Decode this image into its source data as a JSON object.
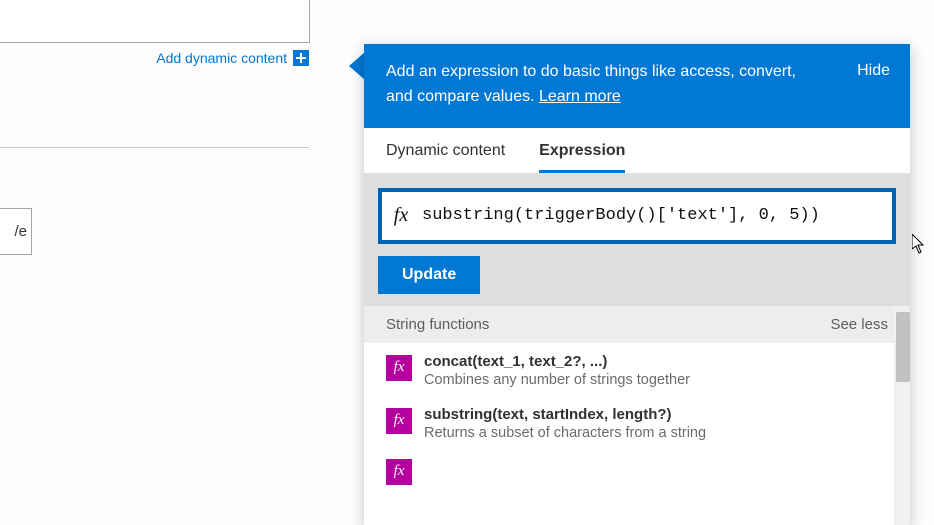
{
  "left": {
    "add_dynamic_label": "Add dynamic content",
    "save_fragment": "/e"
  },
  "header": {
    "description_prefix": "Add an expression to do basic things like access, convert, and compare values. ",
    "learn_more_label": "Learn more",
    "hide_label": "Hide"
  },
  "tabs": {
    "dynamic": "Dynamic content",
    "expression": "Expression",
    "active": "expression"
  },
  "expression": {
    "fx_label": "fx",
    "value": "substring(triggerBody()['text'], 0, 5))",
    "update_label": "Update"
  },
  "functions": {
    "group_title": "String functions",
    "see_less_label": "See less",
    "items": [
      {
        "signature": "concat(text_1, text_2?, ...)",
        "description": "Combines any number of strings together"
      },
      {
        "signature": "substring(text, startIndex, length?)",
        "description": "Returns a subset of characters from a string"
      }
    ]
  },
  "colors": {
    "brand": "#0078d4",
    "fx_chip": "#b4009e"
  }
}
